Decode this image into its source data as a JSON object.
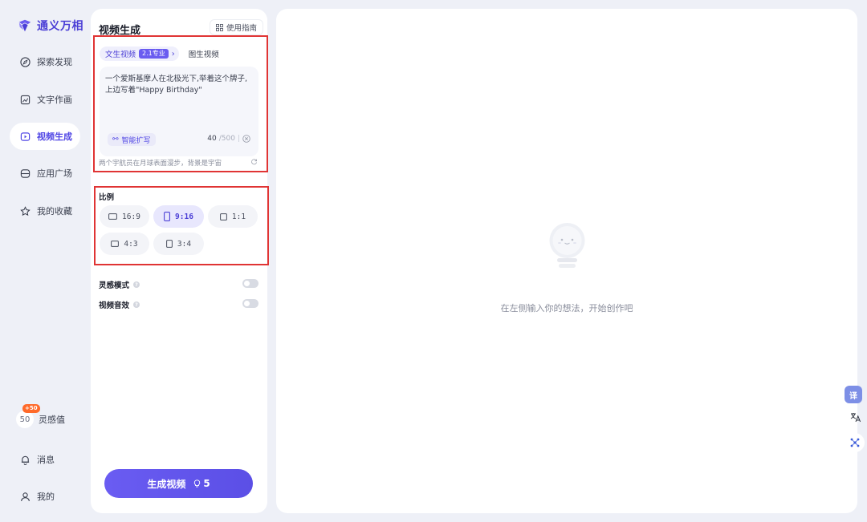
{
  "brand": {
    "name": "通义万相"
  },
  "nav": {
    "items": [
      {
        "label": "探索发现",
        "icon": "compass-icon"
      },
      {
        "label": "文字作画",
        "icon": "image-edit-icon"
      },
      {
        "label": "视频生成",
        "icon": "video-play-icon",
        "active": true
      },
      {
        "label": "应用广场",
        "icon": "app-square-icon"
      },
      {
        "label": "我的收藏",
        "icon": "star-icon"
      }
    ],
    "inspiration": {
      "value": "50",
      "badge": "+50",
      "label": "灵感值"
    },
    "messages_label": "消息",
    "profile_label": "我的"
  },
  "panel": {
    "title": "视频生成",
    "guide_label": "使用指南",
    "tabs": {
      "active_label": "文生视频",
      "active_badge": "2.1专业",
      "other_label": "图生视频"
    },
    "prompt": {
      "text": "一个爱斯基摩人在北极光下,举着这个牌子,上边写着\"Happy Birthday\"",
      "expand_label": "智能扩写",
      "count": "40",
      "max": "/500",
      "suggestion": "两个宇航员在月球表面漫步，背景是宇宙"
    },
    "ratio": {
      "label": "比例",
      "options": [
        "16:9",
        "9:16",
        "1:1",
        "4:3",
        "3:4"
      ],
      "selected": "9:16"
    },
    "toggles": [
      {
        "label": "灵感模式",
        "on": false
      },
      {
        "label": "视频音效",
        "on": false
      }
    ],
    "generate": {
      "label": "生成视频",
      "cost": "5"
    }
  },
  "canvas": {
    "empty_text": "在左侧输入你的想法，开始创作吧"
  },
  "float_tools": {
    "translate_label": "译"
  },
  "colors": {
    "accent": "#5b4fe6",
    "highlight": "#e03434",
    "background": "#eef0f7"
  }
}
